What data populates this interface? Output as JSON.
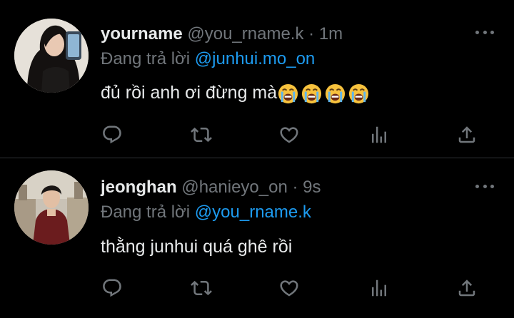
{
  "colors": {
    "background": "#000000",
    "text_primary": "#e7e9ea",
    "text_secondary": "#71767b",
    "link": "#1d9bf0",
    "divider": "#2f3336"
  },
  "tweets": [
    {
      "display_name": "yourname",
      "handle": "@you_rname.k",
      "separator": "·",
      "time": "1m",
      "reply_prefix": "Đang trả lời",
      "reply_target": "@junhui.mo_on",
      "text": "đủ rồi anh ơi đừng mà",
      "emoji": [
        "loudly-crying-face",
        "loudly-crying-face",
        "loudly-crying-face",
        "loudly-crying-face"
      ],
      "actions": [
        "reply-icon",
        "retweet-icon",
        "like-icon",
        "views-icon",
        "share-icon"
      ]
    },
    {
      "display_name": "jeonghan",
      "handle": "@hanieyo_on",
      "separator": "·",
      "time": "9s",
      "reply_prefix": "Đang trả lời",
      "reply_target": "@you_rname.k",
      "text": "thằng junhui quá ghê rồi",
      "emoji": [],
      "actions": [
        "reply-icon",
        "retweet-icon",
        "like-icon",
        "views-icon",
        "share-icon"
      ]
    }
  ]
}
